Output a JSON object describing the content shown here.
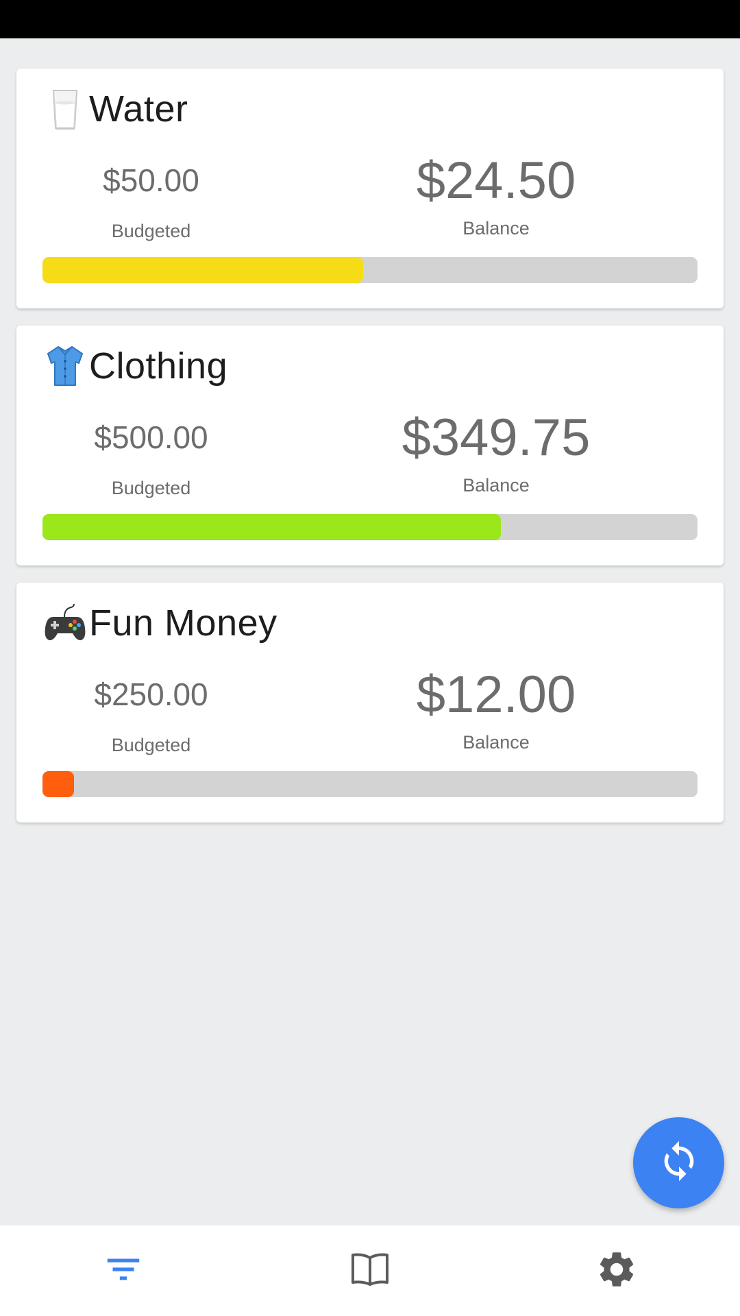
{
  "budgets": [
    {
      "icon": "water-glass-icon",
      "title": "Water",
      "budgeted_amount": "$50.00",
      "budgeted_label": "Budgeted",
      "balance_amount": "$24.50",
      "balance_label": "Balance",
      "progress_fraction": 0.49,
      "progress_color": "#f5dc17"
    },
    {
      "icon": "shirt-icon",
      "title": "Clothing",
      "budgeted_amount": "$500.00",
      "budgeted_label": "Budgeted",
      "balance_amount": "$349.75",
      "balance_label": "Balance",
      "progress_fraction": 0.7,
      "progress_color": "#9ae71a"
    },
    {
      "icon": "game-controller-icon",
      "title": "Fun Money",
      "budgeted_amount": "$250.00",
      "budgeted_label": "Budgeted",
      "balance_amount": "$12.00",
      "balance_label": "Balance",
      "progress_fraction": 0.048,
      "progress_color": "#ff5e0e"
    }
  ],
  "fab": {
    "icon": "sync-icon",
    "color": "#3c82f2"
  },
  "bottom_nav": [
    {
      "icon": "filter-list-icon",
      "active": true,
      "color": "#3c82f2"
    },
    {
      "icon": "book-open-icon",
      "active": false,
      "color": "#5b5b5b"
    },
    {
      "icon": "gear-icon",
      "active": false,
      "color": "#5b5b5b"
    }
  ]
}
